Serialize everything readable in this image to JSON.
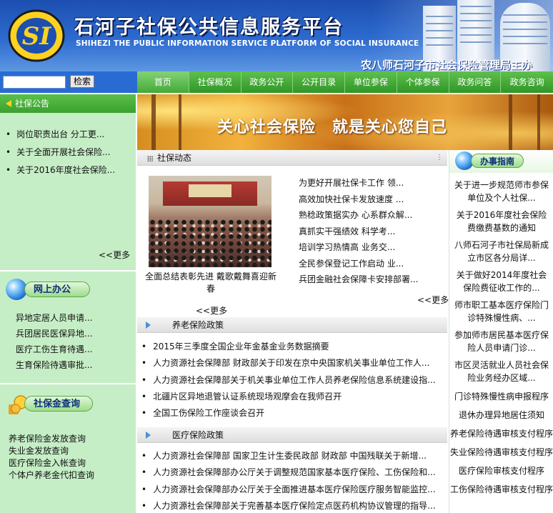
{
  "header": {
    "logo_text": "SI",
    "title": "石河子社保公共信息服务平台",
    "subtitle": "SHIHEZI THE PUBLIC INFORMATION SERVICE PLATFORM OF SOCIAL INSURANCE",
    "sponsor": "农八师石河子市社会保险管理局主办"
  },
  "search": {
    "value": "",
    "button_label": "检索"
  },
  "nav": [
    {
      "label": "首页"
    },
    {
      "label": "社保概况"
    },
    {
      "label": "政务公开"
    },
    {
      "label": "公开目录"
    },
    {
      "label": "单位参保"
    },
    {
      "label": "个体参保"
    },
    {
      "label": "政务问答"
    },
    {
      "label": "政务咨询"
    }
  ],
  "notices": {
    "title": "社保公告",
    "items": [
      "岗位职责出台 分工更...",
      "关于全面开展社会保险...",
      "关于2016年度社会保险..."
    ],
    "more": "<<更多"
  },
  "online_office": {
    "title": "网上办公",
    "items": [
      "异地定居人员申请...",
      "兵团居民医保异地...",
      "医疗工伤生育待遇...",
      "生育保险待遇审批..."
    ]
  },
  "fund_query": {
    "title": "社保金查询",
    "items": [
      "养老保险金发放查询",
      "失业金发放查询",
      "医疗保险金入帐查询",
      "个体户养老金代扣查询"
    ]
  },
  "hero": {
    "slogan": "关心社会保险　就是关心您自己"
  },
  "news": {
    "title": "社保动态",
    "photo_caption": "全面总结表彰先进 戴歌戴舞喜迎新春",
    "items": [
      "为更好开展社保卡工作 领...",
      "高效加快社保卡发放速度 ...",
      "熟稔政策据实办 心系群众解...",
      "真抓实干强绩效 科学考...",
      "培训学习热情高 业务交...",
      "全民参保登记工作启动 业...",
      "兵团金融社会保障卡安排部署..."
    ],
    "more_right": "<<更多",
    "more_left": "<<更多"
  },
  "pension_policy": {
    "title": "养老保险政策",
    "items": [
      "2015年三季度全国企业年金基金业务数据摘要",
      "人力资源社会保障部 财政部关于印发在京中央国家机关事业单位工作人...",
      "人力资源社会保障部关于机关事业单位工作人员养老保险信息系统建设指...",
      "北疆片区异地退管认证系统现场观摩会在我师召开",
      "全国工伤保险工作座谈会召开"
    ]
  },
  "medical_policy": {
    "title": "医疗保险政策",
    "items": [
      "人力资源社会保障部 国家卫生计生委民政部 财政部 中国残联关于新增...",
      "人力资源社会保障部办公厅关于调整规范国家基本医疗保险、工伤保险和...",
      "人力资源社会保障部办公厅关于全面推进基本医疗保险医疗服务智能监控...",
      "人力资源社会保障部关于完善基本医疗保险定点医药机构协议管理的指导..."
    ]
  },
  "guide": {
    "title": "办事指南",
    "items": [
      "关于进一步规范师市参保单位及个人社保...",
      "关于2016年度社会保险费缴费基数的通知",
      "八师石河子市社保局新成立市区各分局详...",
      "关于做好2014年度社会保险费征收工作的...",
      "师市职工基本医疗保险门诊特殊慢性病、...",
      "参加师市居民基本医疗保险人员申请门诊...",
      "市区灵活就业人员社会保险业务经办区域...",
      "门诊特殊慢性病申报程序",
      "退休办理异地居住须知",
      "养老保险待遇审核支付程序",
      "失业保险待遇审核支付程序",
      "医疗保险审核支付程序",
      "工伤保险待遇审核支付程序"
    ]
  }
}
